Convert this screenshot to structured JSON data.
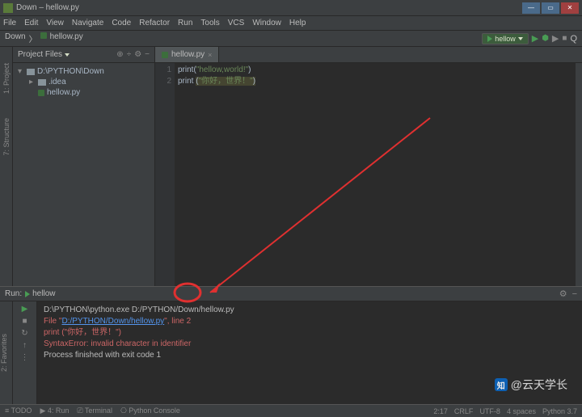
{
  "window": {
    "title": "Down – hellow.py"
  },
  "menu": [
    "File",
    "Edit",
    "View",
    "Navigate",
    "Code",
    "Refactor",
    "Run",
    "Tools",
    "VCS",
    "Window",
    "Help"
  ],
  "breadcrumb": {
    "root": "Down",
    "file": "hellow.py"
  },
  "run_config": {
    "name": "hellow"
  },
  "project": {
    "panel_label": "Project Files",
    "root": "D:\\PYTHON\\Down",
    "children": [
      {
        "name": ".idea",
        "type": "dir"
      },
      {
        "name": "hellow.py",
        "type": "py"
      }
    ]
  },
  "sidetabs": {
    "project": "1: Project",
    "structure": "7: Structure",
    "favorites": "2: Favorites"
  },
  "editor": {
    "tab": "hellow.py",
    "lines": [
      {
        "n": "1",
        "pre": "print",
        "paren_open": "(",
        "str": "\"hellow,world!\"",
        "paren_close": ")"
      },
      {
        "n": "2",
        "pre": "print ",
        "paren_open": "(",
        "str": "\"你好，世界！\"",
        "paren_close": ")"
      }
    ]
  },
  "run": {
    "title_prefix": "Run:",
    "title_name": "hellow",
    "out": {
      "cmd": "D:\\PYTHON\\python.exe D:/PYTHON/Down/hellow.py",
      "file_pre": "  File \"",
      "file_link": "D:/PYTHON/Down/hellow.py",
      "file_mid": "\", line 2",
      "echo": "    print (\"你好，世界！\")",
      "blank1": "",
      "err": "SyntaxError: invalid character in identifier",
      "blank2": "",
      "exit": "Process finished with exit code 1"
    }
  },
  "status": {
    "tabs": [
      "≡ TODO",
      "▶ 4: Run",
      "⎚ Terminal",
      "⎔ Python Console"
    ],
    "cursor": "2:17",
    "eol": "CRLF",
    "enc": "UTF-8",
    "indent": "4 spaces",
    "python": "Python 3.7"
  },
  "watermark": "@云天学长",
  "icons": {
    "gear": "⚙",
    "minus": "−",
    "help": "?",
    "down": "▾",
    "close": "×",
    "reload": "↻",
    "stop": "■",
    "up": "↑",
    "mag": "⚲",
    "bug": "⬢",
    "more": "⋮"
  }
}
